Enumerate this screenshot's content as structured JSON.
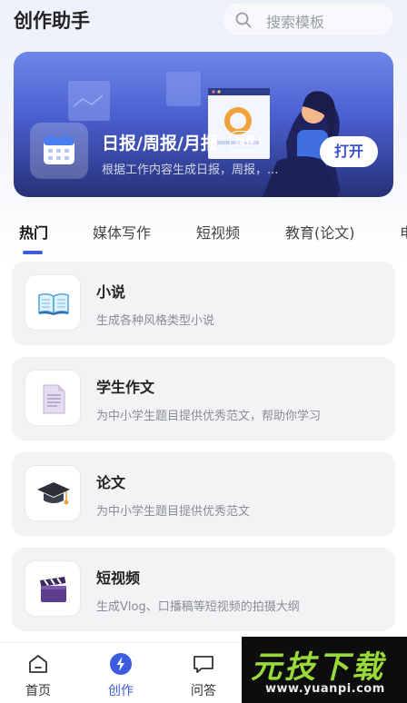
{
  "header": {
    "title": "创作助手",
    "search_placeholder": "搜索模板"
  },
  "banner": {
    "title": "日报/周报/月报",
    "badge": "推荐",
    "subtitle": "根据工作内容生成日报，周报，...",
    "open_label": "打开"
  },
  "tabs": [
    {
      "label": "热门",
      "active": true
    },
    {
      "label": "媒体写作"
    },
    {
      "label": "短视频"
    },
    {
      "label": "教育(论文)"
    },
    {
      "label": "电"
    }
  ],
  "cards": [
    {
      "title": "小说",
      "desc": "生成各种风格类型小说",
      "icon": "open-book-icon"
    },
    {
      "title": "学生作文",
      "desc": "为中小学生题目提供优秀范文，帮助你学习",
      "icon": "document-icon"
    },
    {
      "title": "论文",
      "desc": "为中小学生题目提供优秀范文",
      "icon": "graduation-cap-icon"
    },
    {
      "title": "短视频",
      "desc": "生成Vlog、口播稿等短视频的拍摄大纲",
      "icon": "clapperboard-icon"
    }
  ],
  "nav": [
    {
      "label": "首页",
      "icon": "home-icon"
    },
    {
      "label": "创作",
      "icon": "lightning-icon",
      "active": true
    },
    {
      "label": "问答",
      "icon": "chat-bubble-icon"
    }
  ],
  "watermark": {
    "brand": "元技下载",
    "url": "www.yuanpi.com"
  },
  "colors": {
    "accent": "#3d5ce0",
    "banner_top": "#6f87e8",
    "banner_bottom": "#263177",
    "card_bg": "#f2f3f5",
    "watermark_green": "#9ad93a"
  }
}
